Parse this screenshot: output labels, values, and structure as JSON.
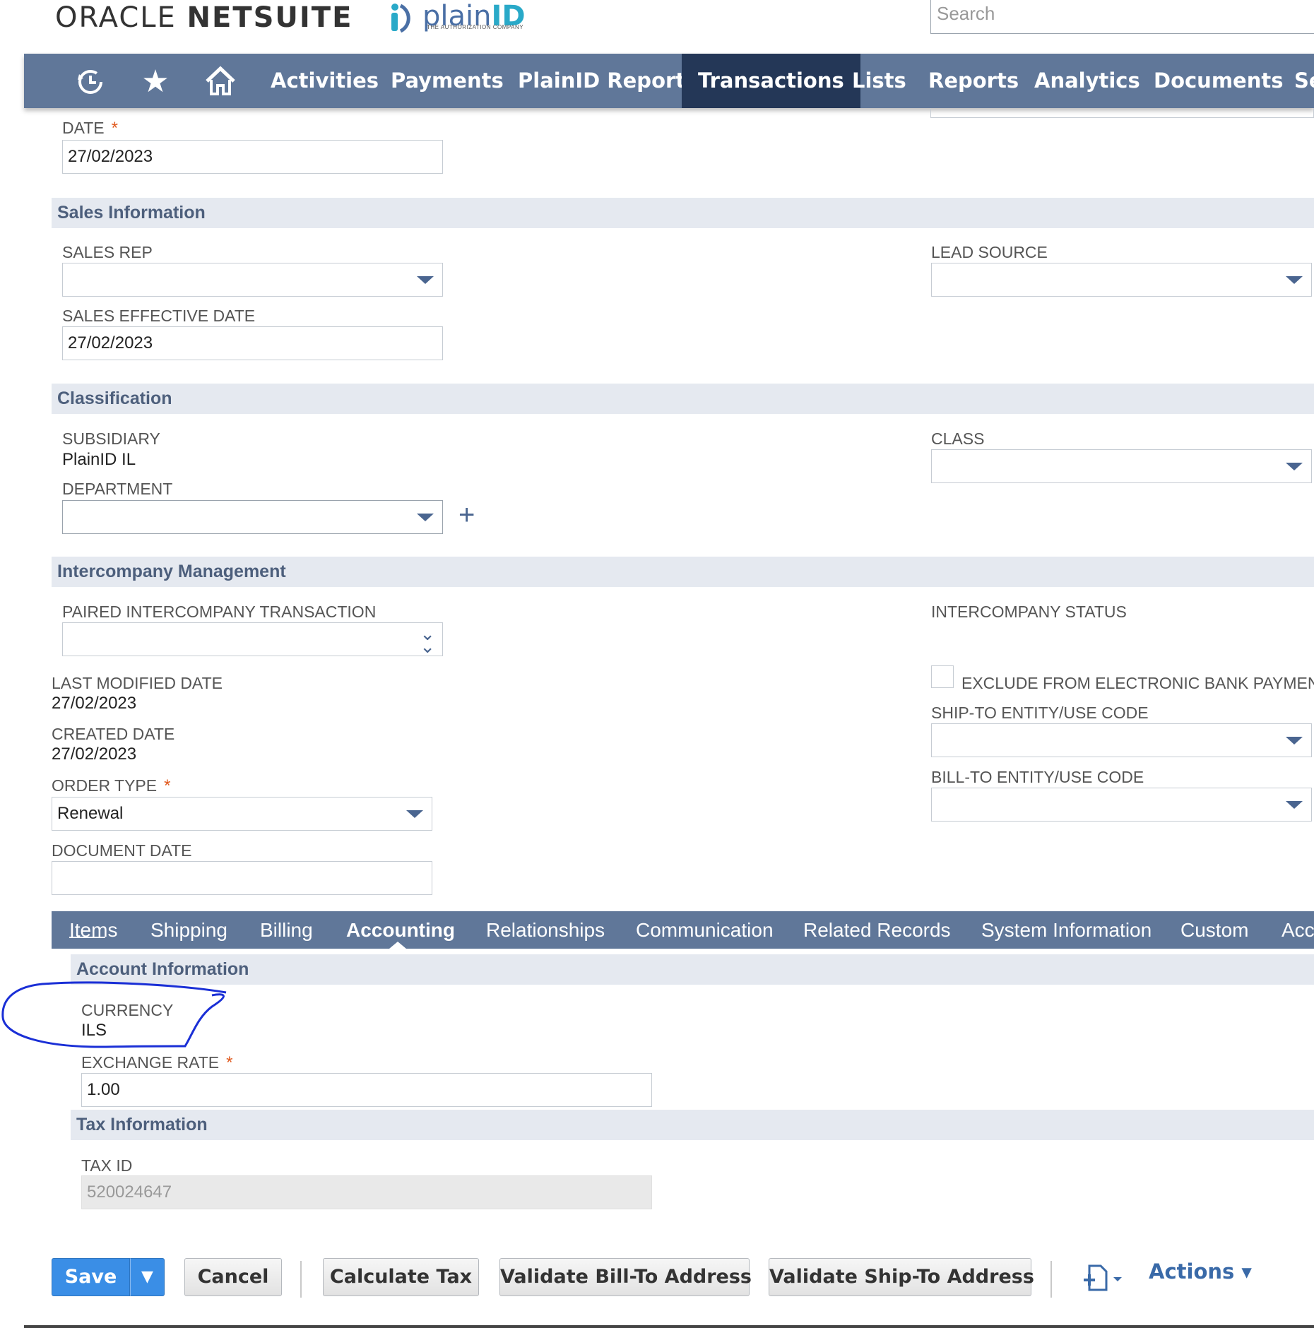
{
  "header": {
    "oracle_logo_a": "ORACLE",
    "oracle_logo_b": "NETSUITE",
    "plainid_logo_a": "plain",
    "plainid_logo_b": "ID",
    "plainid_tagline": "THE AUTHORIZATION COMPANY",
    "search_placeholder": "Search"
  },
  "nav": {
    "icons": [
      "recent-icon",
      "star-icon",
      "home-icon"
    ],
    "items": [
      "Activities",
      "Payments",
      "PlainID Reports",
      "Transactions",
      "Lists",
      "Reports",
      "Analytics",
      "Documents",
      "Se"
    ],
    "active": "Transactions"
  },
  "top_fields": {
    "date_label": "DATE",
    "date_value": "27/02/2023"
  },
  "sales_info": {
    "title": "Sales Information",
    "sales_rep_label": "SALES REP",
    "sales_rep_value": "",
    "lead_source_label": "LEAD SOURCE",
    "lead_source_value": "",
    "sales_effective_date_label": "SALES EFFECTIVE DATE",
    "sales_effective_date_value": "27/02/2023"
  },
  "classification": {
    "title": "Classification",
    "subsidiary_label": "SUBSIDIARY",
    "subsidiary_value": "PlainID IL",
    "class_label": "CLASS",
    "department_label": "DEPARTMENT"
  },
  "intercompany": {
    "title": "Intercompany Management",
    "paired_label": "PAIRED INTERCOMPANY TRANSACTION",
    "status_label": "INTERCOMPANY STATUS",
    "exclude_label": "EXCLUDE FROM ELECTRONIC BANK PAYMEN",
    "exclude_checked": false,
    "last_modified_label": "LAST MODIFIED DATE",
    "last_modified_value": "27/02/2023",
    "created_label": "CREATED DATE",
    "created_value": "27/02/2023",
    "ship_to_label": "SHIP-TO ENTITY/USE CODE",
    "order_type_label": "ORDER TYPE",
    "order_type_value": "Renewal",
    "bill_to_label": "BILL-TO ENTITY/USE CODE",
    "document_date_label": "DOCUMENT DATE",
    "document_date_value": ""
  },
  "tabs": {
    "items": [
      "Items",
      "Shipping",
      "Billing",
      "Accounting",
      "Relationships",
      "Communication",
      "Related Records",
      "System Information",
      "Custom",
      "Acc"
    ],
    "active": "Accounting"
  },
  "account_info": {
    "title": "Account Information",
    "currency_label": "CURRENCY",
    "currency_value": "ILS",
    "exchange_rate_label": "EXCHANGE RATE",
    "exchange_rate_value": "1.00"
  },
  "tax_info": {
    "title": "Tax Information",
    "tax_id_label": "TAX ID",
    "tax_id_value": "520024647"
  },
  "buttons": {
    "save": "Save",
    "save_dropdown": "▼",
    "cancel": "Cancel",
    "calculate_tax": "Calculate Tax",
    "validate_bill_to": "Validate Bill-To Address",
    "validate_ship_to": "Validate Ship-To Address",
    "actions": "Actions ▾"
  },
  "colors": {
    "nav_bg": "#607799",
    "nav_active": "#243757",
    "section_bg": "#e5e9f0",
    "save_blue": "#3a8ee6",
    "annotation": "#1a2fd6"
  }
}
